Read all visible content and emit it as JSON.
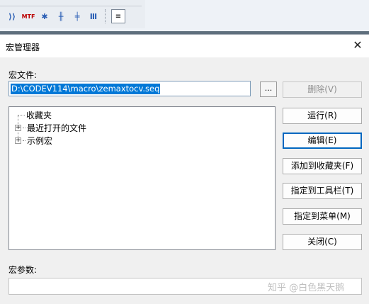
{
  "toolbar": {
    "icons": [
      "ray-trace-icon",
      "mtf-icon",
      "spot-diagram-icon",
      "aberration-icon",
      "field-curves-icon",
      "layout-icon",
      "document-icon"
    ],
    "mtf_text": "MTF"
  },
  "dialog": {
    "title": "宏管理器",
    "close_symbol": "✕",
    "file_label": "宏文件:",
    "file_value": "D:\\CODEV114\\macro\\zemaxtocv.seq",
    "browse_label": "...",
    "tree": [
      {
        "label": "收藏夹",
        "expandable": false
      },
      {
        "label": "最近打开的文件",
        "expandable": true
      },
      {
        "label": "示例宏",
        "expandable": true
      }
    ],
    "buttons": {
      "delete": "删除(V)",
      "run": "运行(R)",
      "edit": "编辑(E)",
      "add_fav": "添加到收藏夹(F)",
      "assign_toolbar": "指定到工具栏(T)",
      "assign_menu": "指定到菜单(M)",
      "close": "关闭(C)"
    },
    "params_label": "宏参数:",
    "params_value": ""
  },
  "watermark": "知乎 @白色黑天鹅"
}
